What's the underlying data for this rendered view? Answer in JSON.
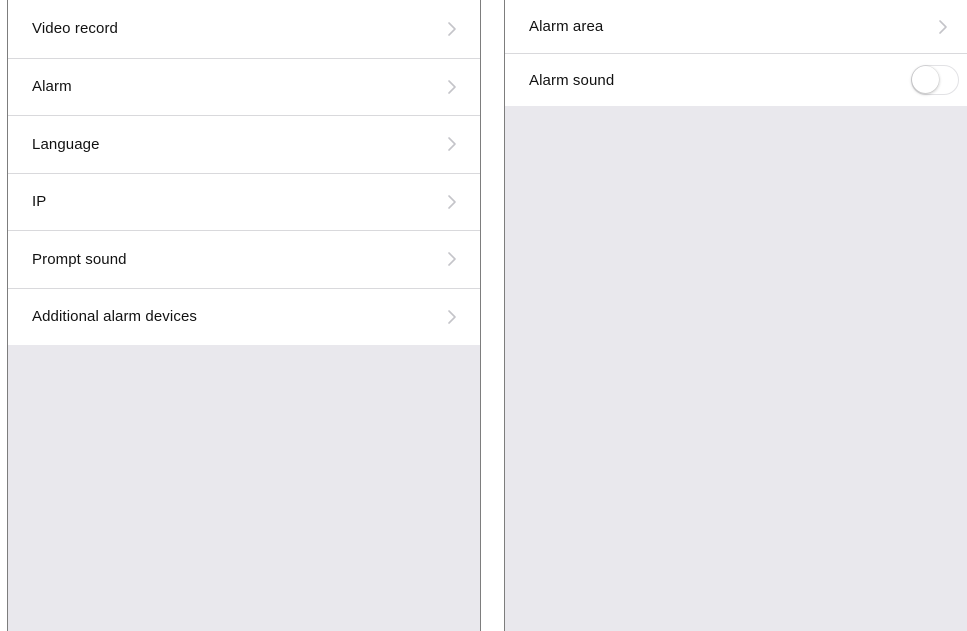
{
  "settings_menu": {
    "items": [
      {
        "label": "Video record",
        "icon": "chevron-right-icon"
      },
      {
        "label": "Alarm",
        "icon": "chevron-right-icon"
      },
      {
        "label": "Language",
        "icon": "chevron-right-icon"
      },
      {
        "label": "IP",
        "icon": "chevron-right-icon"
      },
      {
        "label": "Prompt sound",
        "icon": "chevron-right-icon"
      },
      {
        "label": "Additional alarm devices",
        "icon": "chevron-right-icon"
      }
    ]
  },
  "alarm_settings": {
    "alarm_area": {
      "label": "Alarm area",
      "icon": "chevron-right-icon"
    },
    "alarm_sound": {
      "label": "Alarm sound",
      "toggle_on": false
    }
  },
  "colors": {
    "background": "#e9e8ed",
    "row_background": "#ffffff",
    "separator": "#d9d9dc",
    "chevron": "#c4c4c9",
    "text": "#111111"
  }
}
